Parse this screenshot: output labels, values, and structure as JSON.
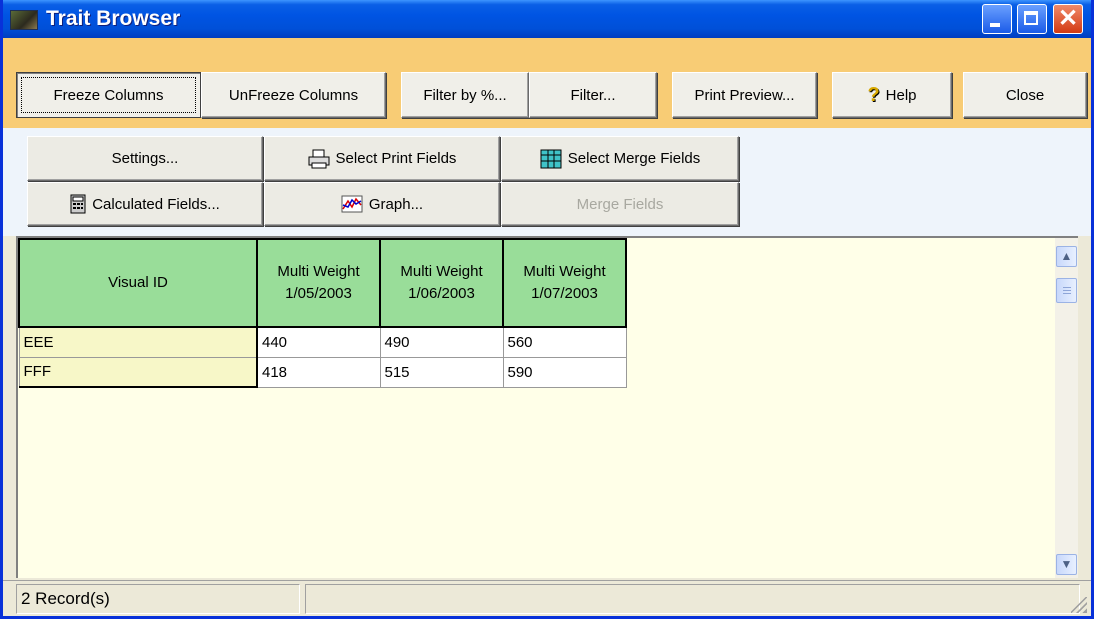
{
  "window": {
    "title": "Trait Browser"
  },
  "toolbar1": {
    "freeze": "Freeze Columns",
    "unfreeze": "UnFreeze Columns",
    "filter_pct": "Filter by %...",
    "filter": "Filter...",
    "print_preview": "Print Preview...",
    "help": "Help",
    "close": "Close"
  },
  "toolbar2": {
    "settings": "Settings...",
    "select_print": "Select Print Fields",
    "select_merge": "Select Merge Fields",
    "calculated": "Calculated Fields...",
    "graph": "Graph...",
    "merge_fields": "Merge Fields"
  },
  "grid": {
    "headers": [
      {
        "line1": "Visual ID",
        "line2": ""
      },
      {
        "line1": "Multi Weight",
        "line2": "1/05/2003"
      },
      {
        "line1": "Multi Weight",
        "line2": "1/06/2003"
      },
      {
        "line1": "Multi Weight",
        "line2": "1/07/2003"
      }
    ],
    "rows": [
      [
        "EEE",
        "440",
        "490",
        "560"
      ],
      [
        "FFF",
        "418",
        "515",
        "590"
      ]
    ]
  },
  "status": {
    "records": "2 Record(s)"
  },
  "icons": [
    "app-icon",
    "minimize-icon",
    "maximize-icon",
    "close-icon",
    "help-icon",
    "printer-icon",
    "table-icon",
    "calculator-icon",
    "graph-icon",
    "scroll-up-icon",
    "scroll-down-icon",
    "resize-grip-icon"
  ]
}
